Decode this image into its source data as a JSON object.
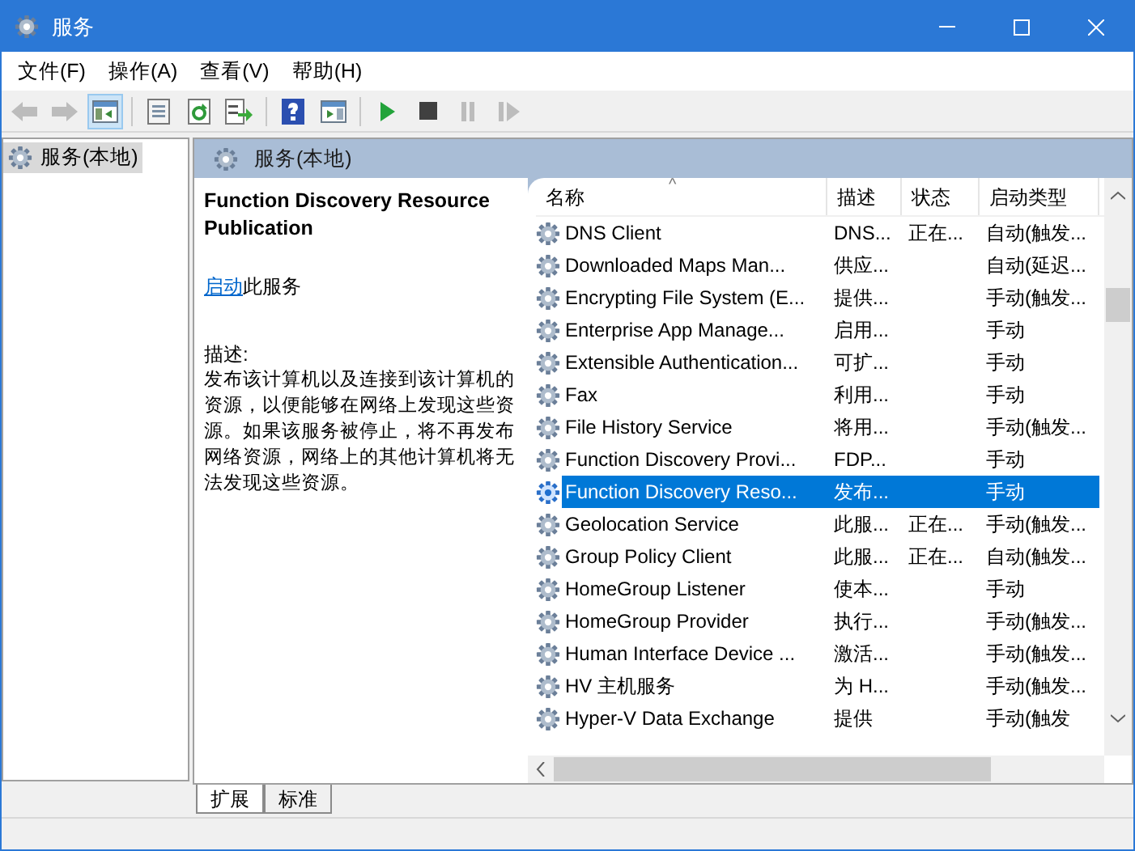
{
  "window": {
    "title": "服务"
  },
  "menu": [
    "文件(F)",
    "操作(A)",
    "查看(V)",
    "帮助(H)"
  ],
  "toolbar": [
    {
      "kind": "back",
      "disabled": true,
      "selected": false
    },
    {
      "kind": "forward",
      "disabled": true,
      "selected": false
    },
    {
      "kind": "tree",
      "disabled": false,
      "selected": true
    },
    {
      "kind": "sep"
    },
    {
      "kind": "props",
      "disabled": false,
      "selected": false
    },
    {
      "kind": "refresh",
      "disabled": false,
      "selected": false
    },
    {
      "kind": "export",
      "disabled": false,
      "selected": false
    },
    {
      "kind": "sep"
    },
    {
      "kind": "help",
      "disabled": false,
      "selected": false
    },
    {
      "kind": "view",
      "disabled": false,
      "selected": false
    },
    {
      "kind": "sep"
    },
    {
      "kind": "play",
      "disabled": false,
      "selected": false
    },
    {
      "kind": "stop",
      "disabled": false,
      "selected": false
    },
    {
      "kind": "pause",
      "disabled": true,
      "selected": false
    },
    {
      "kind": "resume",
      "disabled": true,
      "selected": false
    }
  ],
  "tree": {
    "items": [
      {
        "label": "服务(本地)",
        "selected": true
      }
    ]
  },
  "panel": {
    "title": "服务(本地)",
    "service_name": "Function Discovery Resource Publication",
    "action_link": "启动",
    "action_text": "此服务",
    "description_label": "描述:",
    "description": "发布该计算机以及连接到该计算机的资源，以便能够在网络上发现这些资源。如果该服务被停止，将不再发布网络资源，网络上的其他计算机将无法发现这些资源。"
  },
  "table": {
    "columns": [
      "名称",
      "描述",
      "状态",
      "启动类型"
    ],
    "sort_indicator": "^",
    "rows": [
      {
        "name": "DNS Client",
        "description": "DNS...",
        "status": "正在...",
        "startup": "自动(触发...",
        "selected": false
      },
      {
        "name": "Downloaded Maps Man...",
        "description": "供应...",
        "status": "",
        "startup": "自动(延迟...",
        "selected": false
      },
      {
        "name": "Encrypting File System (E...",
        "description": "提供...",
        "status": "",
        "startup": "手动(触发...",
        "selected": false
      },
      {
        "name": "Enterprise App Manage...",
        "description": "启用...",
        "status": "",
        "startup": "手动",
        "selected": false
      },
      {
        "name": "Extensible Authentication...",
        "description": "可扩...",
        "status": "",
        "startup": "手动",
        "selected": false
      },
      {
        "name": "Fax",
        "description": "利用...",
        "status": "",
        "startup": "手动",
        "selected": false
      },
      {
        "name": "File History Service",
        "description": "将用...",
        "status": "",
        "startup": "手动(触发...",
        "selected": false
      },
      {
        "name": "Function Discovery Provi...",
        "description": "FDP...",
        "status": "",
        "startup": "手动",
        "selected": false
      },
      {
        "name": "Function Discovery Reso...",
        "description": "发布...",
        "status": "",
        "startup": "手动",
        "selected": true
      },
      {
        "name": "Geolocation Service",
        "description": "此服...",
        "status": "正在...",
        "startup": "手动(触发...",
        "selected": false
      },
      {
        "name": "Group Policy Client",
        "description": "此服...",
        "status": "正在...",
        "startup": "自动(触发...",
        "selected": false
      },
      {
        "name": "HomeGroup Listener",
        "description": "使本...",
        "status": "",
        "startup": "手动",
        "selected": false
      },
      {
        "name": "HomeGroup Provider",
        "description": "执行...",
        "status": "",
        "startup": "手动(触发...",
        "selected": false
      },
      {
        "name": "Human Interface Device ...",
        "description": "激活...",
        "status": "",
        "startup": "手动(触发...",
        "selected": false
      },
      {
        "name": "HV 主机服务",
        "description": "为 H...",
        "status": "",
        "startup": "手动(触发...",
        "selected": false
      },
      {
        "name": "Hyper-V Data Exchange",
        "description": "提供",
        "status": "",
        "startup": "手动(触发",
        "selected": false
      }
    ]
  },
  "tabs": [
    {
      "label": "扩展",
      "selected": true
    },
    {
      "label": "标准",
      "selected": false
    }
  ]
}
